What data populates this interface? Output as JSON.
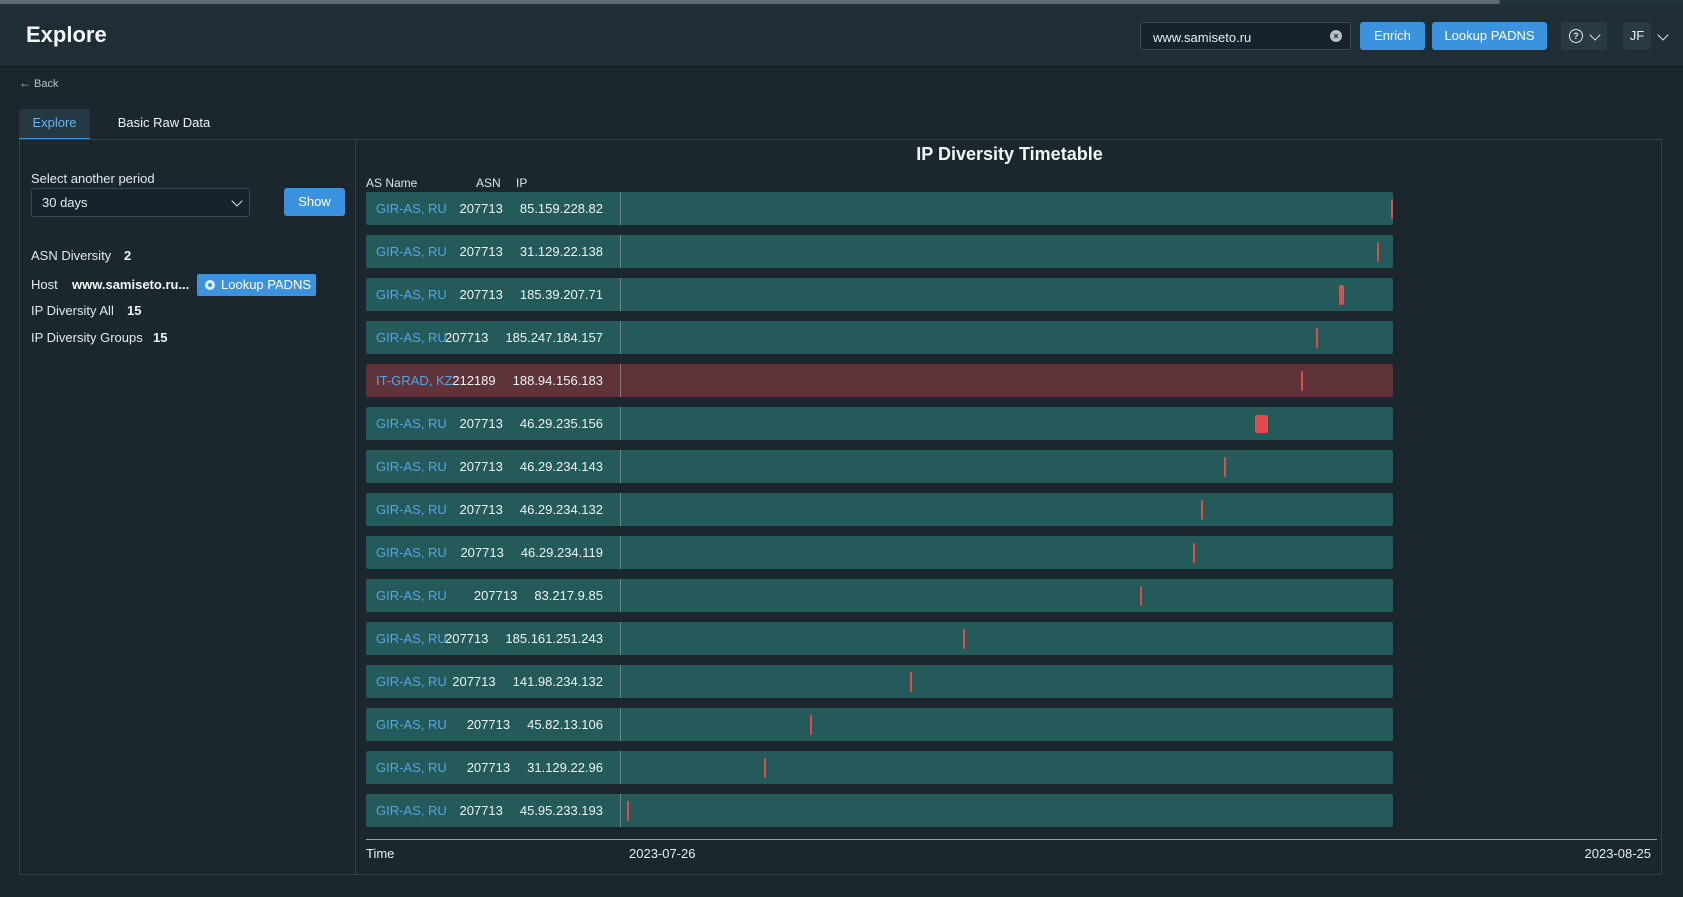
{
  "header": {
    "title": "Explore",
    "search_value": "www.samiseto.ru",
    "clear_glyph": "×",
    "enrich_label": "Enrich",
    "lookup_label": "Lookup PADNS",
    "help_glyph": "?",
    "user_initials": "JF"
  },
  "nav": {
    "back_label": "Back",
    "back_icon": "←"
  },
  "tabs": [
    {
      "label": "Explore",
      "active": true
    },
    {
      "label": "Basic Raw Data",
      "active": false
    }
  ],
  "sidebar": {
    "period_label": "Select another period",
    "period_value": "30 days",
    "show_label": "Show",
    "asn_diversity_label": "ASN Diversity",
    "asn_diversity_value": "2",
    "host_label": "Host",
    "host_value": "www.samiseto.ru...",
    "host_lookup_label": "Lookup PADNS",
    "ip_all_label": "IP Diversity All",
    "ip_all_value": "15",
    "ip_groups_label": "IP Diversity Groups",
    "ip_groups_value": "15"
  },
  "timetable": {
    "title": "IP Diversity Timetable",
    "col_as_name": "AS Name",
    "col_asn": "ASN",
    "col_ip": "IP",
    "time_label": "Time",
    "start_date": "2023-07-26",
    "end_date": "2023-08-25",
    "colors": {
      "row": "#245a5a",
      "row_highlight": "#5e333a",
      "mark": "#e44a4a",
      "link": "#54a6e6"
    },
    "rows": [
      {
        "as_name": "GIR-AS, RU",
        "asn": "207713",
        "ip": "85.159.228.82",
        "highlight": false,
        "pos": 1.0,
        "span": 0.002
      },
      {
        "as_name": "GIR-AS, RU",
        "asn": "207713",
        "ip": "31.129.22.138",
        "highlight": false,
        "pos": 0.98,
        "span": 0.002
      },
      {
        "as_name": "GIR-AS, RU",
        "asn": "207713",
        "ip": "185.39.207.71",
        "highlight": false,
        "pos": 0.933,
        "span": 0.006
      },
      {
        "as_name": "GIR-AS, RU",
        "asn": "207713",
        "ip": "185.247.184.157",
        "highlight": false,
        "pos": 0.902,
        "span": 0.002
      },
      {
        "as_name": "IT-GRAD, KZ",
        "asn": "212189",
        "ip": "188.94.156.183",
        "highlight": true,
        "pos": 0.882,
        "span": 0.002
      },
      {
        "as_name": "GIR-AS, RU",
        "asn": "207713",
        "ip": "46.29.235.156",
        "highlight": false,
        "pos": 0.83,
        "span": 0.017
      },
      {
        "as_name": "GIR-AS, RU",
        "asn": "207713",
        "ip": "46.29.234.143",
        "highlight": false,
        "pos": 0.782,
        "span": 0.002
      },
      {
        "as_name": "GIR-AS, RU",
        "asn": "207713",
        "ip": "46.29.234.132",
        "highlight": false,
        "pos": 0.752,
        "span": 0.002
      },
      {
        "as_name": "GIR-AS, RU",
        "asn": "207713",
        "ip": "46.29.234.119",
        "highlight": false,
        "pos": 0.742,
        "span": 0.002
      },
      {
        "as_name": "GIR-AS, RU",
        "asn": "207713",
        "ip": "83.217.9.85",
        "highlight": false,
        "pos": 0.673,
        "span": 0.002
      },
      {
        "as_name": "GIR-AS, RU",
        "asn": "207713",
        "ip": "185.161.251.243",
        "highlight": false,
        "pos": 0.444,
        "span": 0.002
      },
      {
        "as_name": "GIR-AS, RU",
        "asn": "207713",
        "ip": "141.98.234.132",
        "highlight": false,
        "pos": 0.375,
        "span": 0.002
      },
      {
        "as_name": "GIR-AS, RU",
        "asn": "207713",
        "ip": "45.82.13.106",
        "highlight": false,
        "pos": 0.246,
        "span": 0.002
      },
      {
        "as_name": "GIR-AS, RU",
        "asn": "207713",
        "ip": "31.129.22.96",
        "highlight": false,
        "pos": 0.186,
        "span": 0.002
      },
      {
        "as_name": "GIR-AS, RU",
        "asn": "207713",
        "ip": "45.95.233.193",
        "highlight": false,
        "pos": 0.008,
        "span": 0.002
      }
    ]
  }
}
